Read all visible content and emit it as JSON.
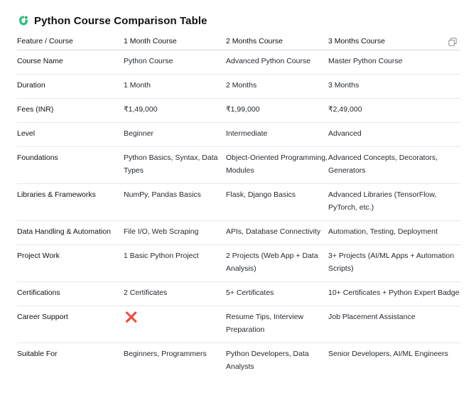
{
  "title": "Python Course Comparison Table",
  "icon": "pycharm-logo-icon",
  "accent": "#2cc07a",
  "headers": [
    "Feature / Course",
    "1 Month Course",
    "2 Months Course",
    "3 Months Course"
  ],
  "rows": [
    [
      "Course Name",
      "Python Course",
      "Advanced Python Course",
      "Master Python Course"
    ],
    [
      "Duration",
      "1 Month",
      "2 Months",
      "3 Months"
    ],
    [
      "Fees (INR)",
      "₹1,49,000",
      "₹1,99,000",
      "₹2,49,000"
    ],
    [
      "Level",
      "Beginner",
      "Intermediate",
      "Advanced"
    ],
    [
      "Foundations",
      "Python Basics, Syntax, Data Types",
      "Object-Oriented Programming, Modules",
      "Advanced Concepts, Decorators, Generators"
    ],
    [
      "Libraries & Frameworks",
      "NumPy, Pandas Basics",
      "Flask, Django Basics",
      "Advanced Libraries (TensorFlow, PyTorch, etc.)"
    ],
    [
      "Data Handling & Automation",
      "File I/O, Web Scraping",
      "APIs, Database Connectivity",
      "Automation, Testing, Deployment"
    ],
    [
      "Project Work",
      "1 Basic Python Project",
      "2 Projects (Web App + Data Analysis)",
      "3+ Projects (AI/ML Apps + Automation Scripts)"
    ],
    [
      "Certifications",
      "2 Certificates",
      "5+ Certificates",
      "10+ Certificates + Python Expert Badge"
    ],
    [
      "Career Support",
      "❌",
      "Resume Tips, Interview Preparation",
      "Job Placement Assistance"
    ],
    [
      "Suitable For",
      "Beginners, Programmers",
      "Python Developers, Data Analysts",
      "Senior Developers, AI/ML Engineers"
    ]
  ],
  "copy_icon": "copy-icon",
  "cross_color": "#e0577a"
}
